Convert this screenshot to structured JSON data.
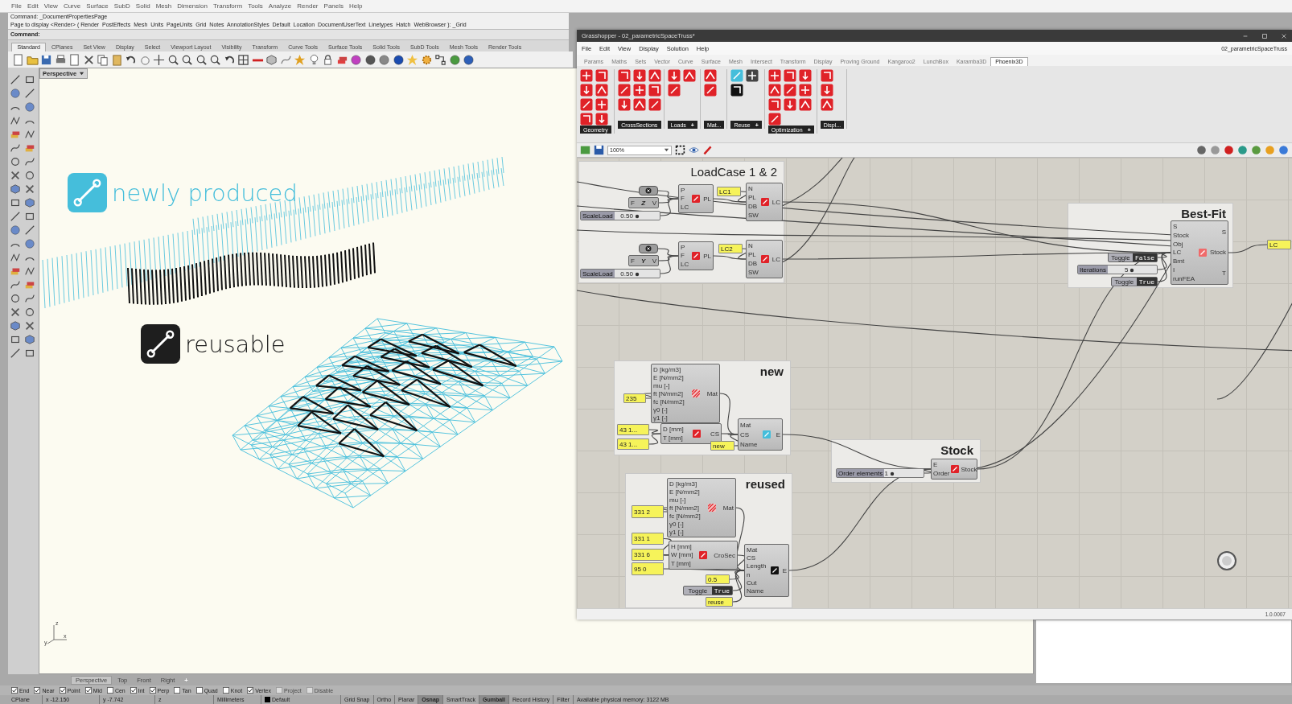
{
  "rhino": {
    "menu": [
      "File",
      "Edit",
      "View",
      "Curve",
      "Surface",
      "SubD",
      "Solid",
      "Mesh",
      "Dimension",
      "Transform",
      "Tools",
      "Analyze",
      "Render",
      "Panels",
      "Help"
    ],
    "command_history": [
      "Command: _DocumentPropertiesPage",
      "Page to display <Render> ( Render  PostEffects  Mesh  Units  PageUnits  Grid  Notes  AnnotationStyles  Default  Location  DocumentUserText  Linetypes  Hatch  WebBrowser ): _Grid"
    ],
    "command_prompt": "Command:",
    "toolbar_tabs": [
      {
        "label": "Standard",
        "selected": true
      },
      {
        "label": "CPlanes",
        "selected": false
      },
      {
        "label": "Set View",
        "selected": false
      },
      {
        "label": "Display",
        "selected": false
      },
      {
        "label": "Select",
        "selected": false
      },
      {
        "label": "Viewport Layout",
        "selected": false
      },
      {
        "label": "Visibility",
        "selected": false
      },
      {
        "label": "Transform",
        "selected": false
      },
      {
        "label": "Curve Tools",
        "selected": false
      },
      {
        "label": "Surface Tools",
        "selected": false
      },
      {
        "label": "Solid Tools",
        "selected": false
      },
      {
        "label": "SubD Tools",
        "selected": false
      },
      {
        "label": "Mesh Tools",
        "selected": false
      },
      {
        "label": "Render Tools",
        "selected": false
      }
    ],
    "viewport": {
      "title": "Perspective",
      "legend": [
        {
          "kind": "new",
          "label": "newly produced"
        },
        {
          "kind": "reused",
          "label": "reusable"
        }
      ],
      "axes": [
        "z",
        "y",
        "x"
      ]
    },
    "view_tabs": [
      {
        "label": "Perspective",
        "selected": true
      },
      {
        "label": "Top",
        "selected": false
      },
      {
        "label": "Front",
        "selected": false
      },
      {
        "label": "Right",
        "selected": false
      }
    ],
    "add_view_tab": "+",
    "osnaps": [
      {
        "label": "End",
        "checked": true,
        "disabled": false
      },
      {
        "label": "Near",
        "checked": true,
        "disabled": false
      },
      {
        "label": "Point",
        "checked": true,
        "disabled": false
      },
      {
        "label": "Mid",
        "checked": true,
        "disabled": false
      },
      {
        "label": "Cen",
        "checked": false,
        "disabled": false
      },
      {
        "label": "Int",
        "checked": true,
        "disabled": false
      },
      {
        "label": "Perp",
        "checked": true,
        "disabled": false
      },
      {
        "label": "Tan",
        "checked": false,
        "disabled": false
      },
      {
        "label": "Quad",
        "checked": false,
        "disabled": false
      },
      {
        "label": "Knot",
        "checked": false,
        "disabled": false
      },
      {
        "label": "Vertex",
        "checked": true,
        "disabled": false
      },
      {
        "label": "Project",
        "checked": false,
        "disabled": true
      },
      {
        "label": "Disable",
        "checked": false,
        "disabled": true
      }
    ],
    "status_fields": [
      {
        "kind": "text",
        "text": "CPlane"
      },
      {
        "kind": "text",
        "text": "x -12.150"
      },
      {
        "kind": "text",
        "text": "y -7.742"
      },
      {
        "kind": "text",
        "text": "z"
      },
      {
        "kind": "text",
        "text": "Millimeters"
      },
      {
        "kind": "layer",
        "text": "Default"
      }
    ],
    "status_toggles": [
      {
        "label": "Grid Snap",
        "on": false
      },
      {
        "label": "Ortho",
        "on": false
      },
      {
        "label": "Planar",
        "on": false
      },
      {
        "label": "Osnap",
        "on": true
      },
      {
        "label": "SmartTrack",
        "on": false
      },
      {
        "label": "Gumball",
        "on": true
      },
      {
        "label": "Record History",
        "on": false
      },
      {
        "label": "Filter",
        "on": false
      }
    ],
    "memory": "Available physical memory: 3122 MB"
  },
  "grasshopper": {
    "title": "Grasshopper - 02_parametricSpaceTruss*",
    "menu": [
      "File",
      "Edit",
      "View",
      "Display",
      "Solution",
      "Help"
    ],
    "document": "02_parametricSpaceTruss",
    "tabs": [
      {
        "label": "Params",
        "selected": false
      },
      {
        "label": "Maths",
        "selected": false
      },
      {
        "label": "Sets",
        "selected": false
      },
      {
        "label": "Vector",
        "selected": false
      },
      {
        "label": "Curve",
        "selected": false
      },
      {
        "label": "Surface",
        "selected": false
      },
      {
        "label": "Mesh",
        "selected": false
      },
      {
        "label": "Intersect",
        "selected": false
      },
      {
        "label": "Transform",
        "selected": false
      },
      {
        "label": "Display",
        "selected": false
      },
      {
        "label": "Proving Ground",
        "selected": false
      },
      {
        "label": "Kangaroo2",
        "selected": false
      },
      {
        "label": "LunchBox",
        "selected": false
      },
      {
        "label": "Karamba3D",
        "selected": false
      },
      {
        "label": "Phoenix3D",
        "selected": true
      }
    ],
    "ribbon_groups": [
      {
        "label": "Geometry"
      },
      {
        "label": "CrossSections"
      },
      {
        "label": "Loads",
        "more": "+"
      },
      {
        "label": "Mat..."
      },
      {
        "label": "Reuse",
        "more": "+"
      },
      {
        "label": "Optimization",
        "more": "+"
      },
      {
        "label": "Displ..."
      }
    ],
    "zoom": "100%",
    "groups": [
      {
        "title": "LoadCase 1 & 2"
      },
      {
        "title": "Best-Fit"
      },
      {
        "title": "new"
      },
      {
        "title": "Stock"
      },
      {
        "title": "reused"
      }
    ],
    "nodes": [
      {
        "kind": "param"
      },
      {
        "kind": "unit_vector",
        "input": "F",
        "label": "Z",
        "output": "V"
      },
      {
        "kind": "slider",
        "label": "ScaleLoad",
        "value": "0.50",
        "level": 0.5
      },
      {
        "kind": "component",
        "inputs": [
          "P",
          "F",
          "LC"
        ],
        "outputs": [
          "PL"
        ]
      },
      {
        "kind": "panel",
        "text": "LC1"
      },
      {
        "kind": "component",
        "inputs": [
          "N",
          "PL",
          "DB",
          "SW"
        ],
        "outputs": [
          "LC"
        ]
      },
      {
        "kind": "param"
      },
      {
        "kind": "unit_vector",
        "input": "F",
        "label": "Y",
        "output": "V"
      },
      {
        "kind": "slider",
        "label": "ScaleLoad",
        "value": "0.50",
        "level": 0.5
      },
      {
        "kind": "component",
        "inputs": [
          "P",
          "F",
          "LC"
        ],
        "outputs": [
          "PL"
        ]
      },
      {
        "kind": "panel",
        "text": "LC2"
      },
      {
        "kind": "component",
        "inputs": [
          "N",
          "PL",
          "DB",
          "SW"
        ],
        "outputs": [
          "LC"
        ]
      },
      {
        "kind": "component",
        "inputs": [
          "S",
          "Stock",
          "Obj",
          "LC",
          "Bmt",
          "I",
          "runFEA"
        ],
        "outputs": [
          "S",
          "Stock",
          "T"
        ]
      },
      {
        "kind": "toggle",
        "label": "Toggle",
        "value": "False"
      },
      {
        "kind": "slider",
        "label": "Iterations",
        "value": "5",
        "level": 0.5
      },
      {
        "kind": "toggle",
        "label": "Toggle",
        "value": "True"
      },
      {
        "kind": "panel",
        "text": "LC"
      },
      {
        "kind": "component",
        "inputs": [
          "D [kg/m3]",
          "E [N/mm2]",
          "mu [-]",
          "ft [N/mm2]",
          "fc [N/mm2]",
          "γ0 [-]",
          "γ1 [-]"
        ],
        "outputs": [
          "Mat"
        ]
      },
      {
        "kind": "panel",
        "text": "235"
      },
      {
        "kind": "panel",
        "text": "43 1..."
      },
      {
        "kind": "panel",
        "text": "43 1..."
      },
      {
        "kind": "component",
        "inputs": [
          "D [mm]",
          "T [mm]"
        ],
        "outputs": [
          "CS"
        ]
      },
      {
        "kind": "panel",
        "text": "new"
      },
      {
        "kind": "component",
        "inputs": [
          "Mat",
          "CS",
          "Name"
        ],
        "outputs": [
          "E"
        ]
      },
      {
        "kind": "slider",
        "label": "Order elements",
        "value": "1",
        "level": 0.2
      },
      {
        "kind": "component",
        "inputs": [
          "E",
          "Order"
        ],
        "outputs": [
          "Stock"
        ]
      },
      {
        "kind": "component",
        "inputs": [
          "D [kg/m3]",
          "E [N/mm2]",
          "mu [-]",
          "ft [N/mm2]",
          "fc [N/mm2]",
          "γ0 [-]",
          "γ1 [-]"
        ],
        "outputs": [
          "Mat"
        ]
      },
      {
        "kind": "panel",
        "text": "331 2"
      },
      {
        "kind": "component",
        "inputs": [
          "H [mm]",
          "W [mm]",
          "T [mm]"
        ],
        "outputs": [
          "CroSec"
        ]
      },
      {
        "kind": "panel",
        "text": "331 1"
      },
      {
        "kind": "panel",
        "text": "331 6"
      },
      {
        "kind": "panel",
        "text": "95 0"
      },
      {
        "kind": "component",
        "inputs": [
          "Mat",
          "CS",
          "Length",
          "n",
          "Cut",
          "Name"
        ],
        "outputs": [
          "E"
        ]
      },
      {
        "kind": "panel",
        "text": "0.5"
      },
      {
        "kind": "toggle",
        "label": "Toggle",
        "value": "True"
      },
      {
        "kind": "panel",
        "text": "reuse"
      }
    ],
    "version": "1.0.0007"
  }
}
